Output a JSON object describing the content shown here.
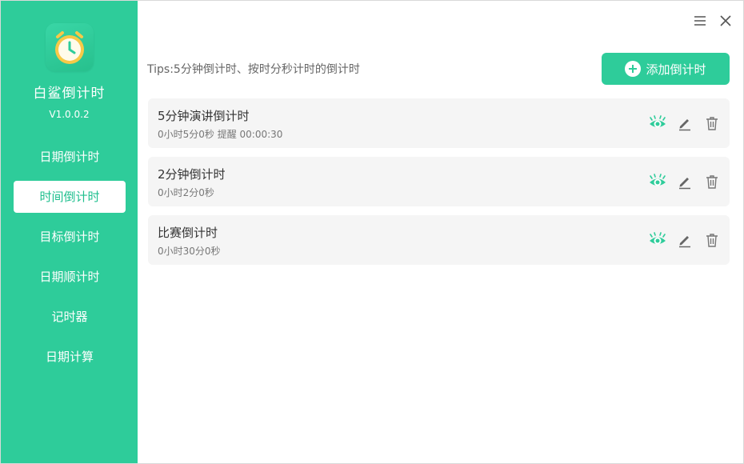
{
  "app": {
    "name": "白鲨倒计时",
    "version": "V1.0.0.2"
  },
  "sidebar": {
    "items": [
      {
        "label": "日期倒计时",
        "active": false
      },
      {
        "label": "时间倒计时",
        "active": true
      },
      {
        "label": "目标倒计时",
        "active": false
      },
      {
        "label": "日期顺计时",
        "active": false
      },
      {
        "label": "记时器",
        "active": false
      },
      {
        "label": "日期计算",
        "active": false
      }
    ]
  },
  "main": {
    "tips": "Tips:5分钟倒计时、按时分秒计时的倒计时",
    "add_label": "添加倒计时",
    "timers": [
      {
        "title": "5分钟演讲倒计时",
        "detail": "0小时5分0秒 提醒 00:00:30"
      },
      {
        "title": "2分钟倒计时",
        "detail": "0小时2分0秒"
      },
      {
        "title": "比赛倒计时",
        "detail": "0小时30分0秒"
      }
    ]
  },
  "icons": {
    "menu": "menu-icon",
    "close": "close-icon",
    "preview": "eye-icon",
    "edit": "pencil-icon",
    "delete": "trash-icon",
    "add": "plus-circle-icon",
    "logo": "alarm-clock-icon"
  },
  "colors": {
    "accent": "#2ecc9a",
    "active_text": "#1fbf8e",
    "item_bg": "#f5f5f5"
  }
}
